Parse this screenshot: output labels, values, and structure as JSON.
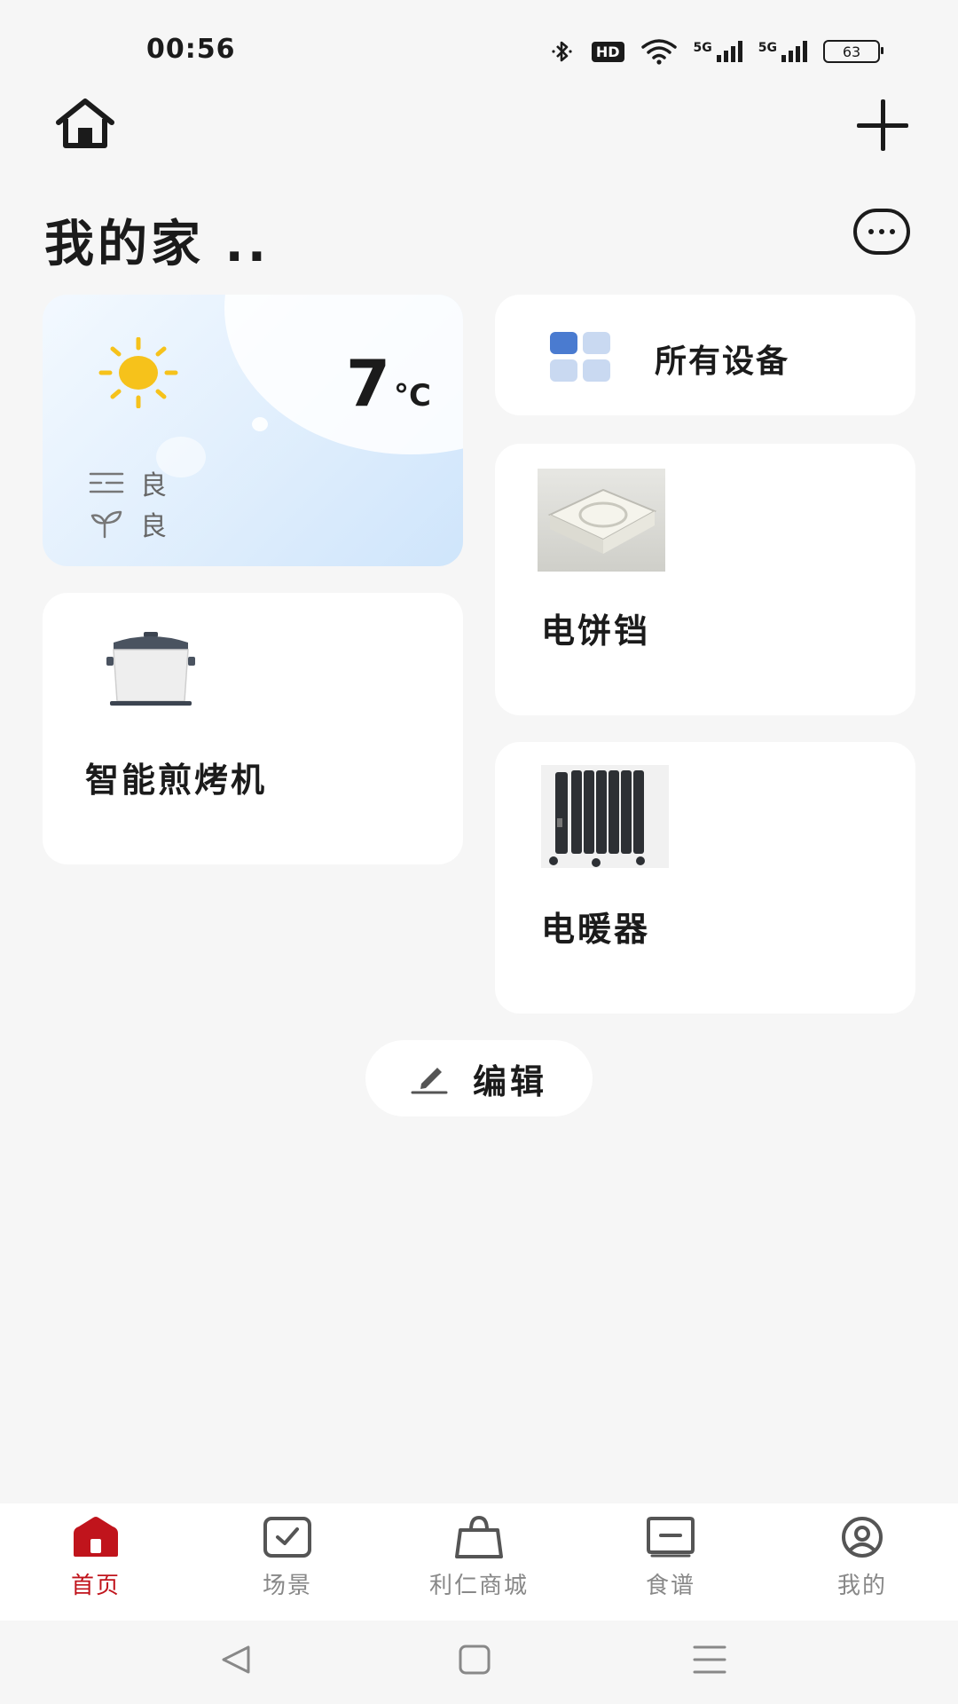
{
  "status_bar": {
    "time": "00:56",
    "hd_label": "HD",
    "network_1": "5G",
    "network_2": "5G",
    "battery": "63"
  },
  "header": {
    "home_icon": "home-outline-icon",
    "add_icon": "plus-icon",
    "title": "我的家 ..",
    "more_icon": "more-circle-icon"
  },
  "weather": {
    "icon": "sun-icon",
    "temperature": "7",
    "unit": "°C",
    "air_quality_icon": "haze-lines-icon",
    "air_quality": "良",
    "plant_icon": "sprout-icon",
    "plant_index": "良"
  },
  "all_devices": {
    "label": "所有设备",
    "icon": "grid-icon",
    "accent": "#4a7bd0"
  },
  "devices": [
    {
      "name": "电饼铛",
      "icon": "griddle-pan-image"
    },
    {
      "name": "智能煎烤机",
      "icon": "cooker-pot-image"
    },
    {
      "name": "电暖器",
      "icon": "oil-radiator-heater-image"
    }
  ],
  "edit": {
    "label": "编辑",
    "icon": "pencil-icon"
  },
  "tabs": [
    {
      "label": "首页",
      "icon": "home-filled-icon",
      "active": true
    },
    {
      "label": "场景",
      "icon": "checkbox-icon",
      "active": false
    },
    {
      "label": "利仁商城",
      "icon": "shopping-bag-icon",
      "active": false
    },
    {
      "label": "食谱",
      "icon": "recipe-card-icon",
      "active": false
    },
    {
      "label": "我的",
      "icon": "profile-circle-icon",
      "active": false
    }
  ],
  "colors": {
    "accent_red": "#c0141c",
    "background": "#f6f6f6",
    "sun": "#f6c21b"
  }
}
